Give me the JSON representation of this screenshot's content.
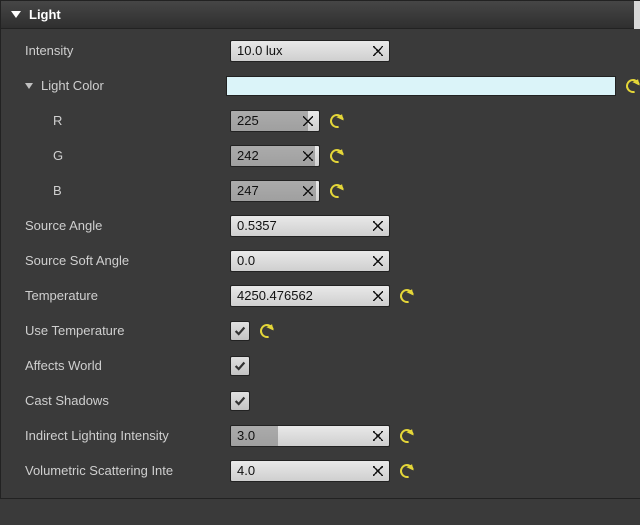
{
  "section": {
    "title": "Light"
  },
  "props": {
    "intensity": {
      "label": "Intensity",
      "value": "10.0 lux"
    },
    "lightColor": {
      "label": "Light Color",
      "hex": "#dbf4f9"
    },
    "r": {
      "label": "R",
      "value": "225"
    },
    "g": {
      "label": "G",
      "value": "242"
    },
    "b": {
      "label": "B",
      "value": "247"
    },
    "sourceAngle": {
      "label": "Source Angle",
      "value": "0.5357"
    },
    "sourceSoftAngle": {
      "label": "Source Soft Angle",
      "value": "0.0"
    },
    "temperature": {
      "label": "Temperature",
      "value": "4250.476562"
    },
    "useTemperature": {
      "label": "Use Temperature",
      "checked": true
    },
    "affectsWorld": {
      "label": "Affects World",
      "checked": true
    },
    "castShadows": {
      "label": "Cast Shadows",
      "checked": true
    },
    "indirectLightingIntensity": {
      "label": "Indirect Lighting Intensity",
      "value": "3.0"
    },
    "volumetricScatteringIntensity": {
      "label": "Volumetric Scattering Intensity",
      "labelTrunc": "Volumetric Scattering Inte",
      "value": "4.0"
    }
  },
  "rgbSliderFill": {
    "r": 88,
    "g": 95,
    "b": 97
  },
  "indirectFillPct": 30
}
